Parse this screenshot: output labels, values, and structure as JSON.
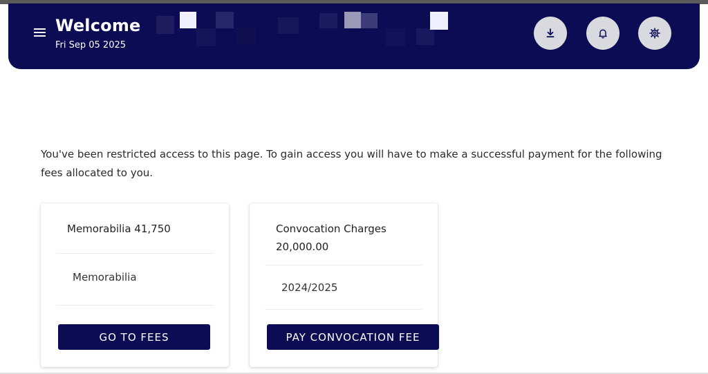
{
  "header": {
    "title": "Welcome",
    "date": "Fri Sep 05 2025",
    "icons": [
      "download-icon",
      "bell-icon",
      "gear-icon"
    ]
  },
  "notice": {
    "text": "You've been restricted access to this page. To gain access you will have to make a successful payment for the following fees allocated to you."
  },
  "cards": [
    {
      "title": "Memorabilia 41,750",
      "subtitle": "Memorabilia",
      "button_label": "GO TO FEES"
    },
    {
      "title": "Convocation Charges 20,000.00",
      "subtitle": "2024/2025",
      "button_label": "PAY CONVOCATION FEE"
    }
  ],
  "colors": {
    "header_bg": "#0c0c55",
    "button_bg": "#0c0c55",
    "icon_button_bg": "#d9d9e0"
  }
}
